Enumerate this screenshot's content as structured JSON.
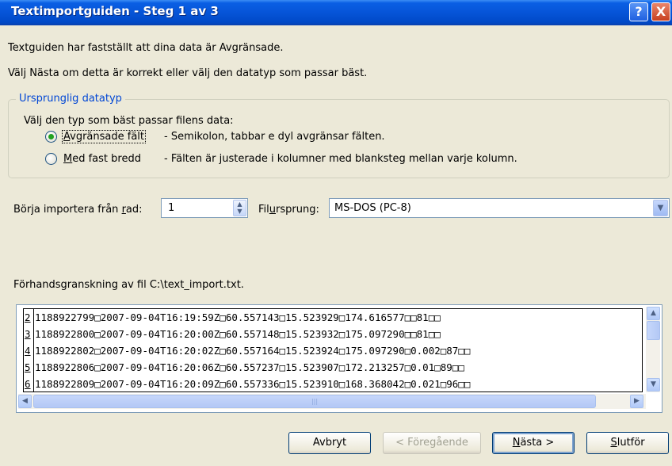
{
  "window": {
    "title": "Textimportguiden - Steg 1 av 3",
    "help_label": "?",
    "close_label": "X"
  },
  "intro": {
    "line1": "Textguiden har fastställt att dina data är Avgränsade.",
    "line2": "Välj Nästa om detta är korrekt eller välj den datatyp som passar bäst."
  },
  "group": {
    "legend": "Ursprunglig datatyp",
    "prompt": "Välj den typ som bäst passar filens data:",
    "options": [
      {
        "key": "A",
        "rest": "vgränsade fält",
        "desc": "- Semikolon, tabbar e dyl avgränsar fälten.",
        "checked": true
      },
      {
        "key": "M",
        "rest": "ed fast bredd",
        "desc": "- Fälten är justerade i kolumner med blanksteg mellan varje kolumn.",
        "checked": false
      }
    ]
  },
  "start_row": {
    "label_pre": "Börja importera från ",
    "label_key": "r",
    "label_post": "ad:",
    "value": "1"
  },
  "origin": {
    "label_pre": "Fil",
    "label_key": "u",
    "label_post": "rsprung:",
    "value": "MS-DOS (PC-8)"
  },
  "preview": {
    "label": "Förhandsgranskning av fil C:\\text_import.txt.",
    "rows": [
      {
        "num": "2",
        "text": "1188922799□2007-09-04T16:19:59Z□60.557143□15.523929□174.616577□□81□□"
      },
      {
        "num": "3",
        "text": "1188922800□2007-09-04T16:20:00Z□60.557148□15.523932□175.097290□□81□□"
      },
      {
        "num": "4",
        "text": "1188922802□2007-09-04T16:20:02Z□60.557164□15.523924□175.097290□0.002□87□□"
      },
      {
        "num": "5",
        "text": "1188922806□2007-09-04T16:20:06Z□60.557237□15.523907□172.213257□0.01□89□□"
      },
      {
        "num": "6",
        "text": "1188922809□2007-09-04T16:20:09Z□60.557336□15.523910□168.368042□0.021□96□□"
      }
    ]
  },
  "buttons": {
    "cancel": "Avbryt",
    "back": "< Föregående",
    "next_key": "N",
    "next_rest": "ästa >",
    "finish_key": "S",
    "finish_rest": "lutför"
  }
}
